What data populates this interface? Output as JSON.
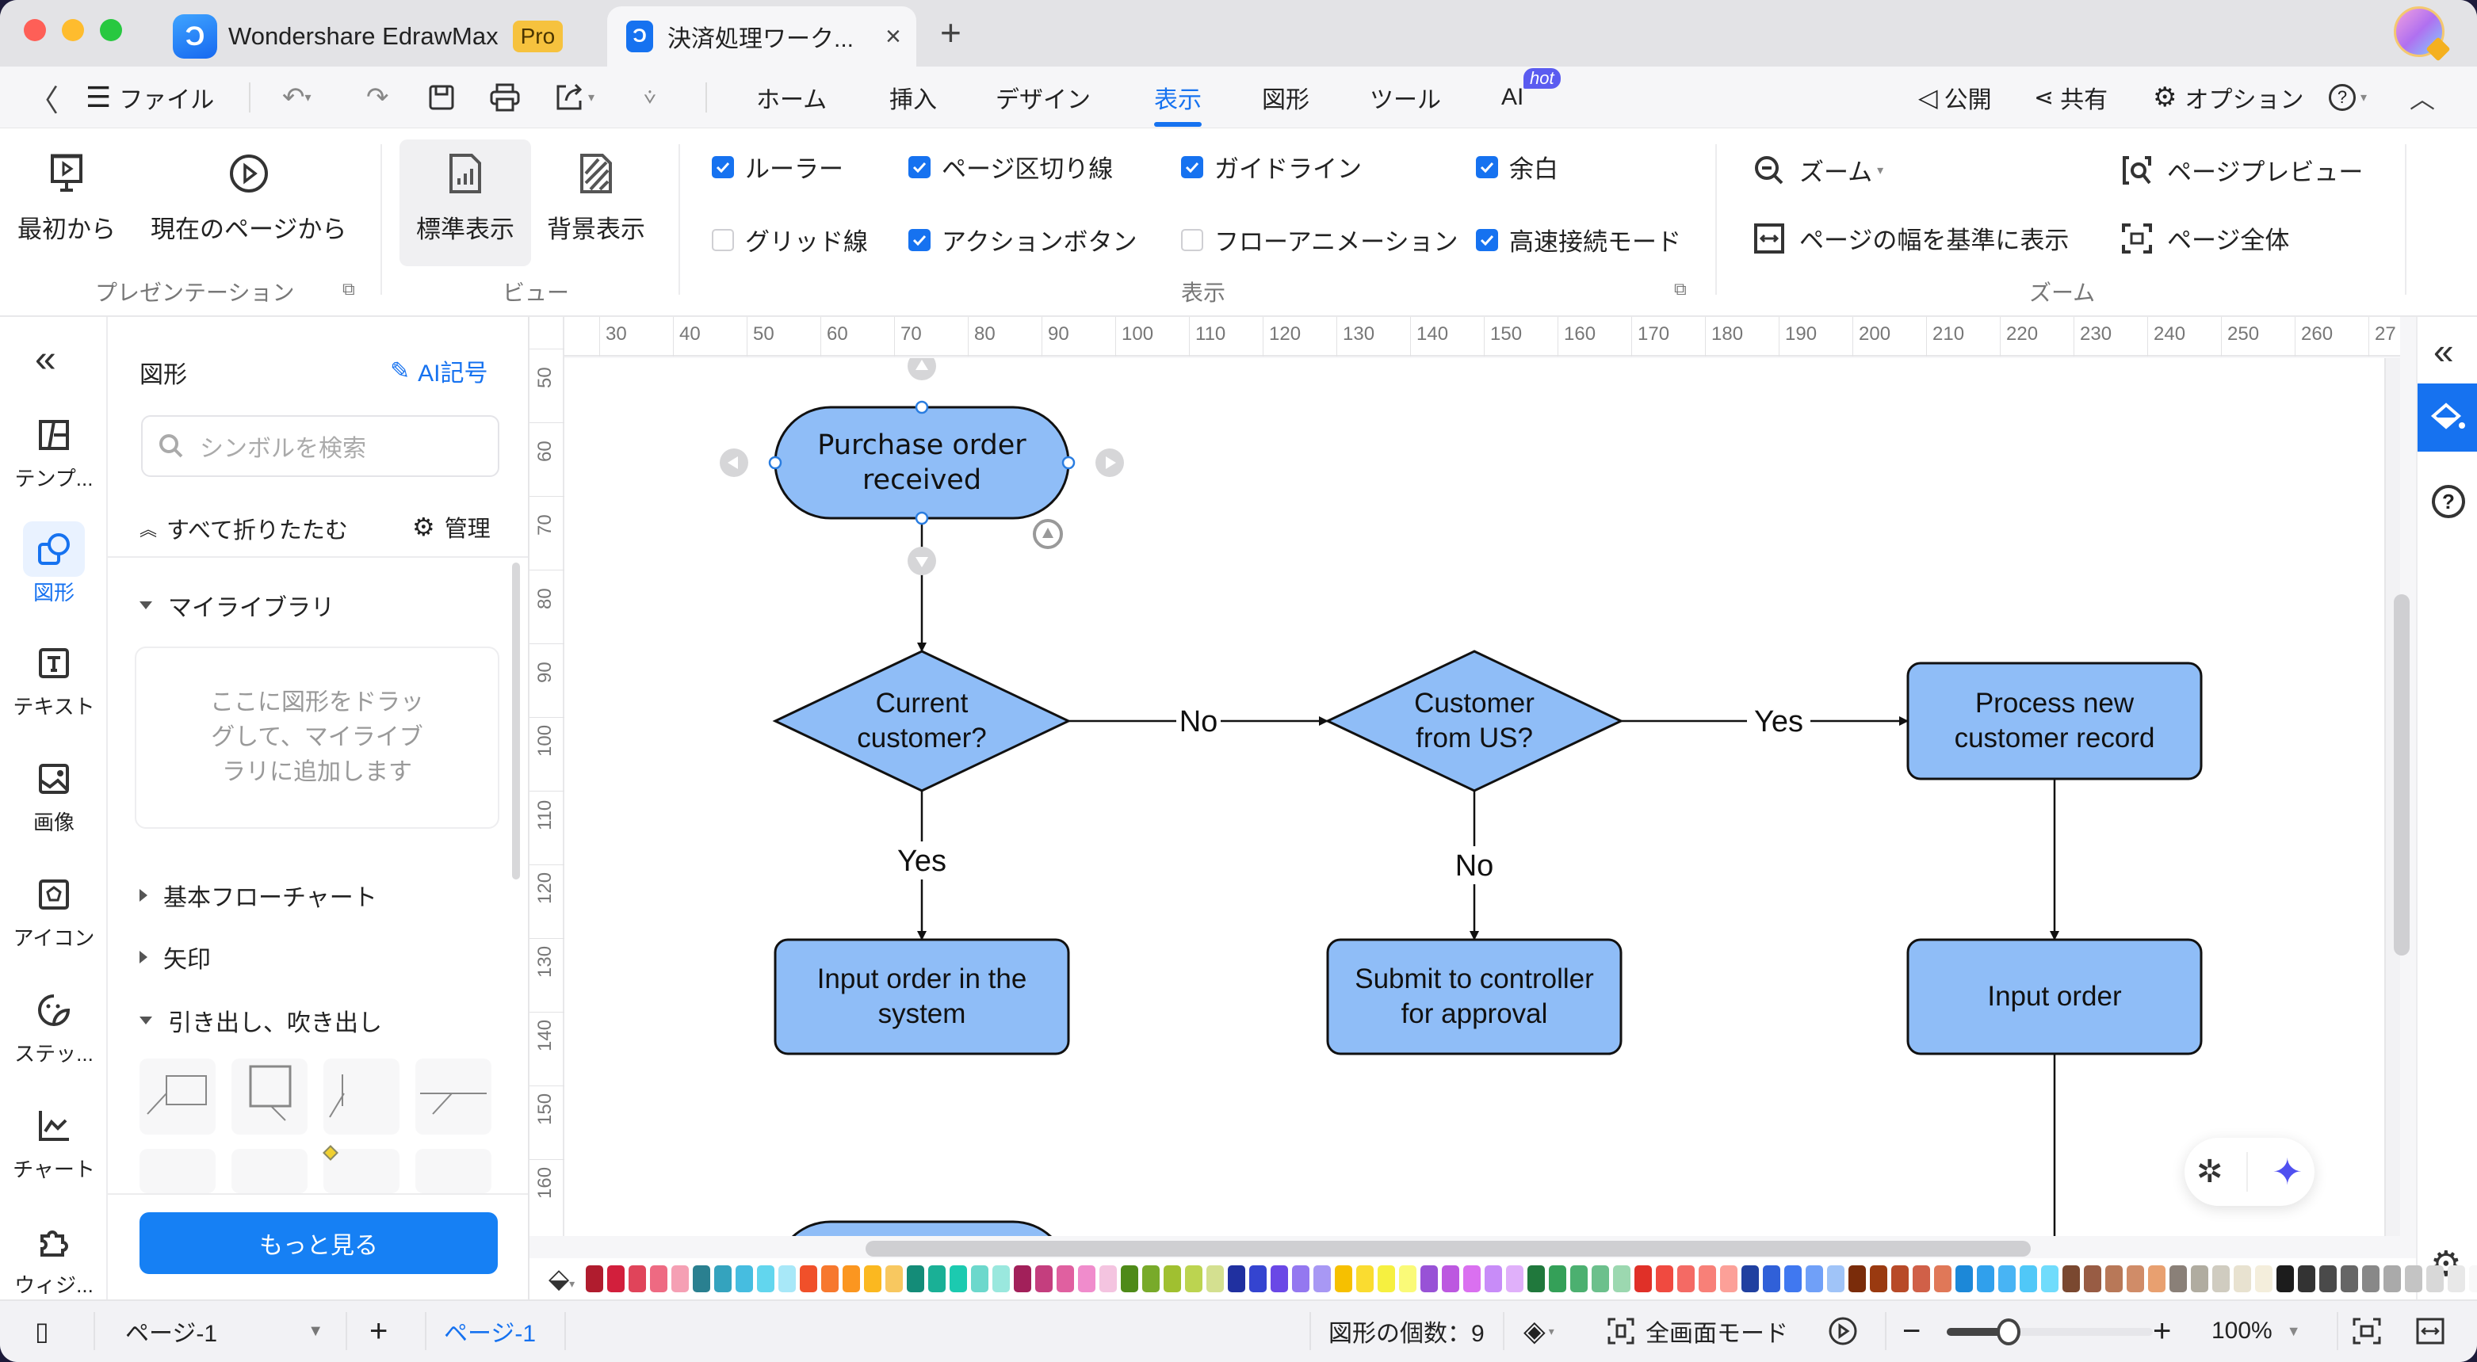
{
  "window": {
    "app_tab_label": "Wondershare EdrawMax",
    "app_badge": "Pro",
    "doc_tab_label": "決済処理ワーク...",
    "close_tab_glyph": "×",
    "new_tab_glyph": "+"
  },
  "menubar": {
    "back_glyph": "〈",
    "file_label": "ファイル",
    "tabs": [
      {
        "label": "ホーム",
        "selected": false
      },
      {
        "label": "挿入",
        "selected": false
      },
      {
        "label": "デザイン",
        "selected": false
      },
      {
        "label": "表示",
        "selected": true
      },
      {
        "label": "図形",
        "selected": false
      },
      {
        "label": "ツール",
        "selected": false
      },
      {
        "label": "AI",
        "selected": false,
        "badge": "hot"
      }
    ],
    "publish_label": "公開",
    "share_label": "共有",
    "options_label": "オプション"
  },
  "ribbon": {
    "presentation": {
      "group_label": "プレゼンテーション",
      "from_start": "最初から",
      "from_current": "現在のページから"
    },
    "view": {
      "group_label": "ビュー",
      "normal": "標準表示",
      "background": "背景表示"
    },
    "display": {
      "group_label": "表示",
      "checkboxes": [
        {
          "label": "ルーラー",
          "checked": true
        },
        {
          "label": "ページ区切り線",
          "checked": true
        },
        {
          "label": "ガイドライン",
          "checked": true
        },
        {
          "label": "余白",
          "checked": true
        },
        {
          "label": "グリッド線",
          "checked": false
        },
        {
          "label": "アクションボタン",
          "checked": true
        },
        {
          "label": "フローアニメーション",
          "checked": false
        },
        {
          "label": "高速接続モード",
          "checked": true
        }
      ]
    },
    "zoom": {
      "group_label": "ズーム",
      "zoom": "ズーム",
      "page_preview": "ページプレビュー",
      "fit_width": "ページの幅を基準に表示",
      "whole_page": "ページ全体"
    }
  },
  "iconbar": {
    "items": [
      {
        "label": "テンプ...",
        "icon": "template-icon",
        "selected": false
      },
      {
        "label": "図形",
        "icon": "shapes-icon",
        "selected": true
      },
      {
        "label": "テキスト",
        "icon": "text-icon",
        "selected": false
      },
      {
        "label": "画像",
        "icon": "image-icon",
        "selected": false
      },
      {
        "label": "アイコン",
        "icon": "icon-library-icon",
        "selected": false
      },
      {
        "label": "ステッ...",
        "icon": "sticker-icon",
        "selected": false
      },
      {
        "label": "チャート",
        "icon": "chart-icon",
        "selected": false
      },
      {
        "label": "ウィジ...",
        "icon": "widget-icon",
        "selected": false
      }
    ]
  },
  "panel": {
    "title": "図形",
    "ai_symbol": "AI記号",
    "search_placeholder": "シンボルを検索",
    "collapse_all": "すべて折りたたむ",
    "manage": "管理",
    "my_library": "マイライブラリ",
    "drop_hint": "ここに図形をドラッグして、マイライブラリに追加します",
    "sections": [
      {
        "label": "基本フローチャート",
        "expanded": false
      },
      {
        "label": "矢印",
        "expanded": false
      },
      {
        "label": "引き出し、吹き出し",
        "expanded": true
      }
    ],
    "more_button": "もっと見る"
  },
  "rulers": {
    "horizontal": [
      "30",
      "40",
      "50",
      "60",
      "70",
      "80",
      "90",
      "100",
      "110",
      "120",
      "130",
      "140",
      "150",
      "160",
      "170",
      "180",
      "190",
      "200",
      "210",
      "220",
      "230",
      "240",
      "250",
      "260",
      "27"
    ],
    "vertical": [
      "50",
      "60",
      "70",
      "80",
      "90",
      "100",
      "110",
      "120",
      "130",
      "140",
      "150",
      "160"
    ]
  },
  "diagram": {
    "fill": "#8fbdf7",
    "stroke": "#111111",
    "nodes": [
      {
        "id": "start",
        "type": "terminator",
        "text": "Purchase  order received",
        "selected": true
      },
      {
        "id": "current",
        "type": "decision",
        "text": "Current customer?"
      },
      {
        "id": "fromus",
        "type": "decision",
        "text": "Customer from US?"
      },
      {
        "id": "newrec",
        "type": "process",
        "text": "Process new customer  record"
      },
      {
        "id": "inputsys",
        "type": "process",
        "text": "Input order in the system"
      },
      {
        "id": "submit",
        "type": "process",
        "text": "Submit to controller for approval"
      },
      {
        "id": "inputorder",
        "type": "process",
        "text": "Input order"
      },
      {
        "id": "end",
        "type": "terminator",
        "text": ""
      }
    ],
    "edges": [
      {
        "from": "start",
        "to": "current",
        "label": ""
      },
      {
        "from": "current",
        "to": "fromus",
        "label": "No"
      },
      {
        "from": "fromus",
        "to": "newrec",
        "label": "Yes"
      },
      {
        "from": "current",
        "to": "inputsys",
        "label": "Yes"
      },
      {
        "from": "fromus",
        "to": "submit",
        "label": "No"
      },
      {
        "from": "newrec",
        "to": "inputorder",
        "label": ""
      }
    ]
  },
  "palette": {
    "colors": [
      "#b01c2e",
      "#d21f3c",
      "#e0445a",
      "#ee6a82",
      "#f5a0b4",
      "#2a8090",
      "#34a3be",
      "#46bde0",
      "#62d6ee",
      "#a8e8f8",
      "#f0502a",
      "#f7782e",
      "#fb9620",
      "#fbb820",
      "#f8c860",
      "#148c78",
      "#1ab096",
      "#1ccab0",
      "#6cd8cc",
      "#9ae8de",
      "#a2205a",
      "#c43e7e",
      "#e060a0",
      "#f08ccc",
      "#f4c4e0",
      "#4e8a18",
      "#78aa2a",
      "#a0c030",
      "#bcd450",
      "#d4e090",
      "#2030a0",
      "#3444d0",
      "#6a48e6",
      "#9478f0",
      "#a898f4",
      "#f6c000",
      "#fadc30",
      "#f6f040",
      "#fafa78",
      "#9852d6",
      "#bc58e0",
      "#da70f0",
      "#c88cf8",
      "#e0b0fa",
      "#20783c",
      "#34a058",
      "#4cb070",
      "#6cc08c",
      "#9cd8b0",
      "#e03028",
      "#f04a40",
      "#f46a64",
      "#f88078",
      "#fca098",
      "#2040a0",
      "#3060d8",
      "#4078f0",
      "#70a0f8",
      "#a0c4f8",
      "#7a2c0a",
      "#9a3a10",
      "#b84a28",
      "#d06048",
      "#e07858",
      "#1c88d8",
      "#30a0ec",
      "#48b4f4",
      "#50c8f8",
      "#70dcfc",
      "#7a4830",
      "#985c44",
      "#b87858",
      "#d08c68",
      "#e8a070",
      "#8a8078",
      "#b0aca0",
      "#d0ccc0",
      "#e8e2d0",
      "#f4eedc",
      "#1c1c1c",
      "#333333",
      "#4a4a4a",
      "#666666",
      "#888888",
      "#aaaaaa",
      "#c4c4c4",
      "#d8d8d8",
      "#e8e8e8",
      "#f8f8f8"
    ]
  },
  "statusbar": {
    "page_select": "ページ-1",
    "add_page_glyph": "+",
    "page_tab": "ページ-1",
    "shape_count": "図形の個数：9",
    "fullscreen": "全画面モード",
    "zoom_value": "100%",
    "zoom_slider_fraction": 0.3
  }
}
